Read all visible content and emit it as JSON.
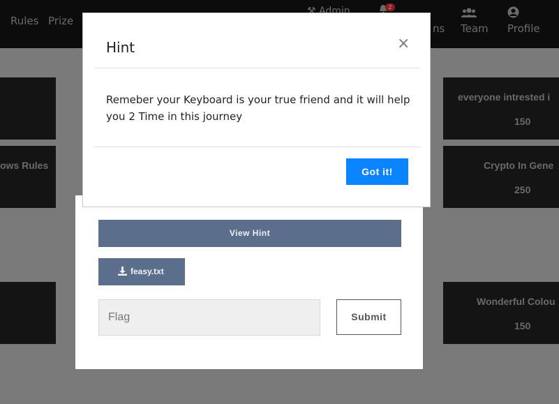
{
  "navbar": {
    "rules": "Rules",
    "prizes": "Prize",
    "admin": "Admin",
    "notification_count": "2",
    "notifications_partial": "ns",
    "team": "Team",
    "profile": "Profile"
  },
  "cards": [
    {
      "title": "",
      "points": ""
    },
    {
      "title": "everyone intrested i",
      "points": "150"
    },
    {
      "title": "ows Rules",
      "points": ""
    },
    {
      "title": "Crypto In Gene",
      "points": "250"
    },
    {
      "title": "",
      "points": ""
    },
    {
      "title": "Wonderful Colou",
      "points": "150"
    }
  ],
  "challenge_modal": {
    "view_hint_label": "View Hint",
    "file_label": "feasy.txt",
    "flag_placeholder": "Flag",
    "submit_label": "Submit"
  },
  "hint_modal": {
    "title": "Hint",
    "close_symbol": "×",
    "body": "Remeber your Keyboard is your true friend and it will help you 2 Time in this journey",
    "button_label": "Got it!"
  },
  "colors": {
    "primary_button": "#0a84ff",
    "secondary_button": "#5b6f8c",
    "overlay": "#7a7a7a",
    "navbar": "#0c0c0c",
    "card": "#141414"
  }
}
